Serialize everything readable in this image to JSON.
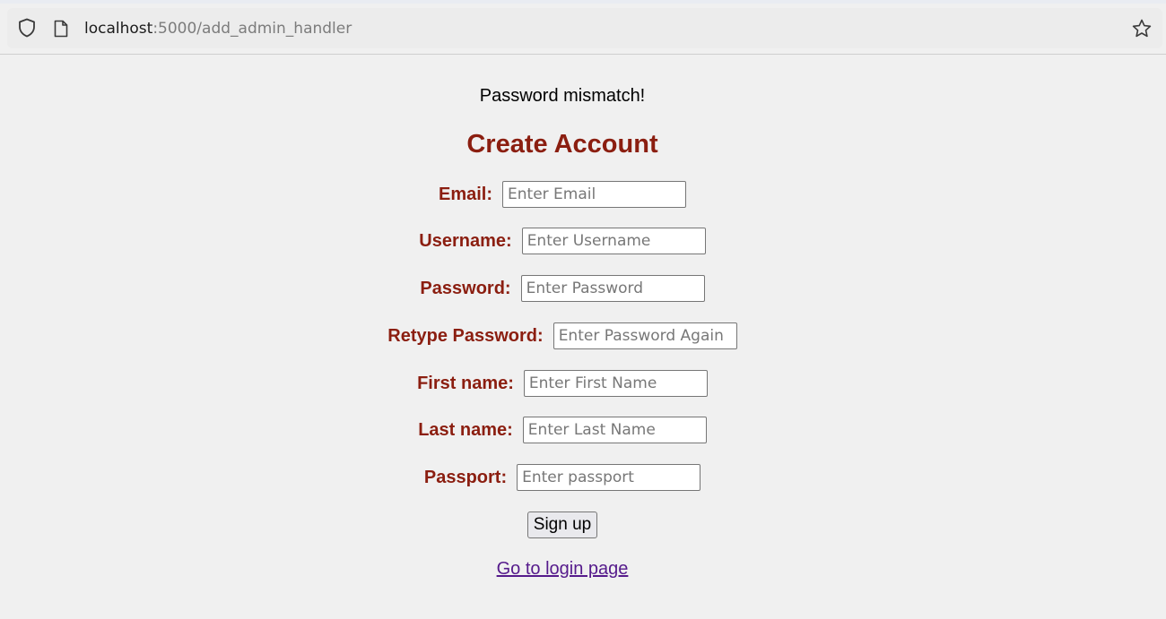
{
  "browser": {
    "url_host": "localhost",
    "url_path": ":5000/add_admin_handler"
  },
  "page": {
    "message": "Password mismatch!",
    "title": "Create Account",
    "fields": [
      {
        "label": "Email:",
        "placeholder": "Enter Email",
        "value": ""
      },
      {
        "label": "Username:",
        "placeholder": "Enter Username",
        "value": ""
      },
      {
        "label": "Password:",
        "placeholder": "Enter Password",
        "value": ""
      },
      {
        "label": "Retype Password:",
        "placeholder": "Enter Password Again",
        "value": ""
      },
      {
        "label": "First name:",
        "placeholder": "Enter First Name",
        "value": ""
      },
      {
        "label": "Last name:",
        "placeholder": "Enter Last Name",
        "value": ""
      },
      {
        "label": "Passport:",
        "placeholder": "Enter passport",
        "value": ""
      }
    ],
    "submit_label": "Sign up",
    "login_link": "Go to login page"
  },
  "colors": {
    "accent": "#8b1e10",
    "link": "#551a8b",
    "background": "#f0f0f0"
  },
  "icons": [
    "shield-icon",
    "page-icon",
    "star-icon"
  ]
}
